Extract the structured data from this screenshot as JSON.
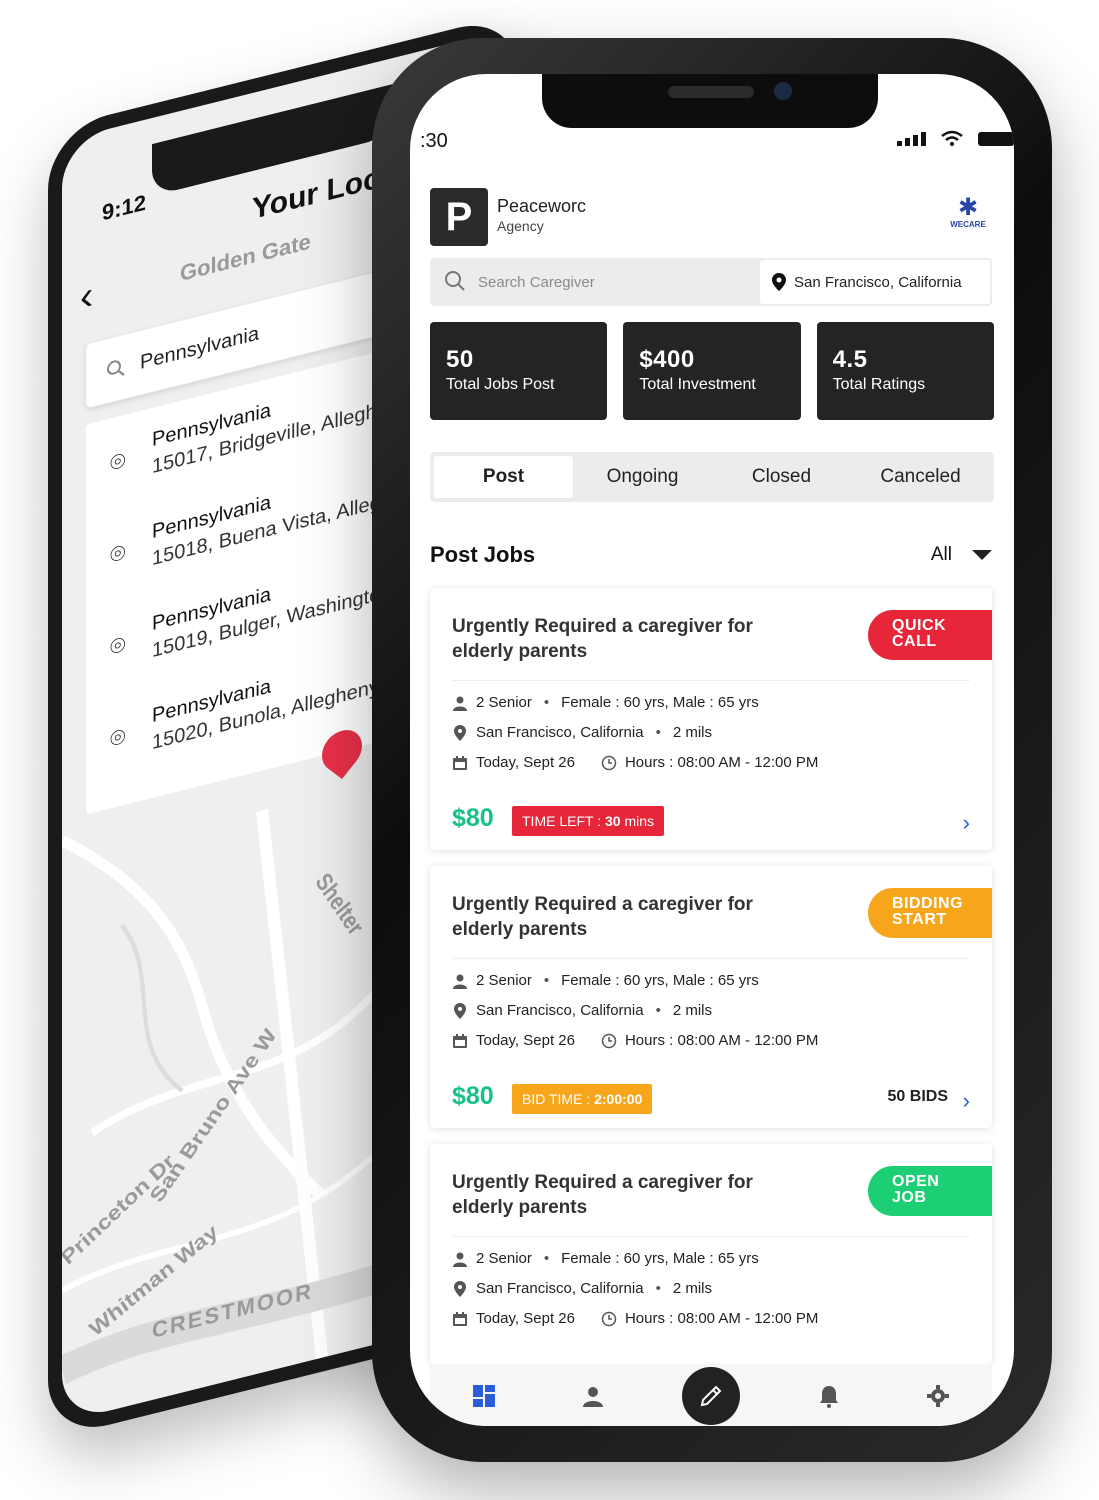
{
  "back_phone": {
    "status_time": "9:12",
    "title": "Your Locat",
    "search_value": "Pennsylvania",
    "results": [
      {
        "title": "Pennsylvania",
        "detail": "15017, Bridgeville, Alleghen"
      },
      {
        "title": "Pennsylvania",
        "detail": "15018, Buena Vista, Allegh"
      },
      {
        "title": "Pennsylvania",
        "detail": "15019, Bulger, Washington"
      },
      {
        "title": "Pennsylvania",
        "detail": "15020, Bunola, Allegheny C"
      }
    ],
    "map_labels": [
      "Golden Gate",
      "San Bruno Ave W",
      "Princeton Dr",
      "Whitman Way",
      "CRESTMOOR",
      "Shelter"
    ]
  },
  "status": {
    "time": ":30"
  },
  "header": {
    "brand_name": "Peaceworc",
    "brand_sub": "Agency",
    "logo_letter": "P",
    "partner_logo_text": "WECARE"
  },
  "search": {
    "placeholder": "Search Caregiver",
    "location": "San Francisco, California"
  },
  "stats": [
    {
      "value": "50",
      "label": "Total Jobs Post"
    },
    {
      "value": "$400",
      "label": "Total Investment"
    },
    {
      "value": "4.5",
      "label": "Total Ratings"
    }
  ],
  "tabs": [
    "Post",
    "Ongoing",
    "Closed",
    "Canceled"
  ],
  "section": {
    "title": "Post Jobs",
    "filter": "All"
  },
  "jobs": [
    {
      "title": "Urgently Required a caregiver for elderly parents",
      "badge_line1": "QUICK",
      "badge_line2": "CALL",
      "seniors": "2 Senior",
      "ages": "Female : 60 yrs, Male : 65 yrs",
      "location": "San Francisco, California",
      "distance": "2 mils",
      "date": "Today, Sept 26",
      "hours": "Hours : 08:00 AM - 12:00 PM",
      "price": "$80",
      "timer_label": "TIME LEFT : ",
      "timer_value": "30",
      "timer_unit": " mins"
    },
    {
      "title": "Urgently Required a caregiver for elderly parents",
      "badge_line1": "BIDDING",
      "badge_line2": "START",
      "seniors": "2 Senior",
      "ages": "Female : 60 yrs, Male : 65 yrs",
      "location": "San Francisco, California",
      "distance": "2 mils",
      "date": "Today, Sept 26",
      "hours": "Hours : 08:00 AM - 12:00 PM",
      "price": "$80",
      "timer_label": "BID TIME : ",
      "timer_value": "2:00:00",
      "timer_unit": "",
      "bids": "50 BIDS"
    },
    {
      "title": "Urgently Required a caregiver for elderly parents",
      "badge_line1": "OPEN",
      "badge_line2": "JOB",
      "seniors": "2 Senior",
      "ages": "Female : 60 yrs, Male : 65 yrs",
      "location": "San Francisco, California",
      "distance": "2 mils",
      "date": "Today, Sept 26",
      "hours": "Hours : 08:00 AM - 12:00 PM"
    }
  ],
  "nav": [
    "dashboard-icon",
    "profile-icon",
    "edit-icon",
    "bell-icon",
    "settings-icon"
  ],
  "colors": {
    "accent_blue": "#2b5bd6",
    "price_green": "#17c28a",
    "quick_red": "#e8263a",
    "bid_orange": "#f7a61b",
    "open_green": "#1ccf74",
    "dark_card": "#242424"
  }
}
